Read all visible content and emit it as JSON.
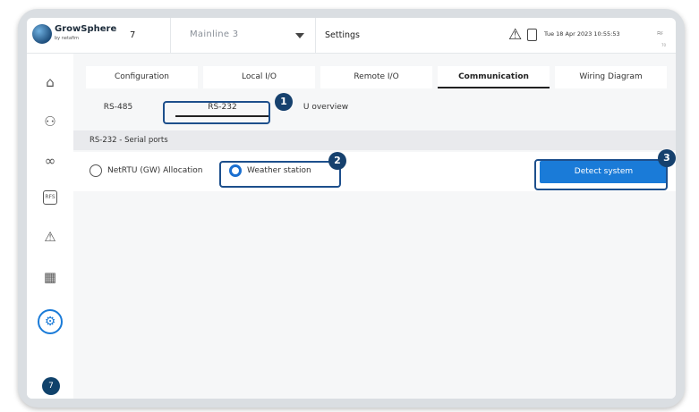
{
  "header": {
    "brand": "GrowSphere",
    "brand_sub": "by netafim",
    "line_number": "7",
    "mainline": "Mainline 3",
    "page_title": "Settings",
    "datetime": "Tue 18 Apr 2023  10:55:53",
    "signal_sub": "70"
  },
  "sidebar": {
    "items": [
      {
        "name": "home",
        "glyph": "⌂"
      },
      {
        "name": "network",
        "glyph": "⚇"
      },
      {
        "name": "link",
        "glyph": "∞"
      },
      {
        "name": "rfs",
        "glyph": "RFS"
      },
      {
        "name": "alarm",
        "glyph": "⚠"
      },
      {
        "name": "table",
        "glyph": "▦"
      },
      {
        "name": "settings",
        "glyph": "⚙"
      }
    ],
    "avatar": "7"
  },
  "tabs": [
    "Configuration",
    "Local I/O",
    "Remote I/O",
    "Communication",
    "Wiring Diagram"
  ],
  "active_tab": "Communication",
  "subtabs": [
    "RS-485",
    "RS-232",
    "U overview"
  ],
  "active_subtab": "RS-232",
  "section": {
    "title": "RS-232 - Serial ports"
  },
  "options": [
    {
      "label": "NetRTU (GW) Allocation",
      "checked": false
    },
    {
      "label": "Weather station",
      "checked": true
    }
  ],
  "detect_button": "Detect system",
  "callouts": [
    "1",
    "2",
    "3"
  ],
  "colors": {
    "accent": "#1a7bd8",
    "callout": "#16416e"
  }
}
